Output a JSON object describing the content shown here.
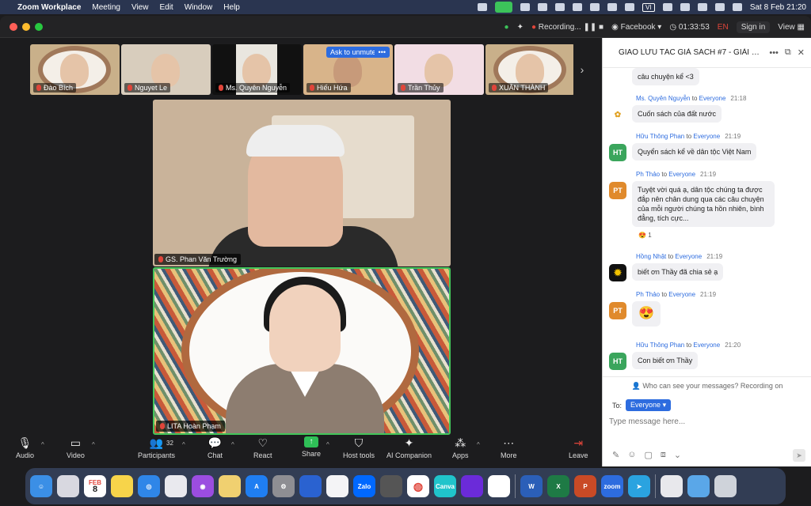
{
  "menubar": {
    "app": "Zoom Workplace",
    "items": [
      "Meeting",
      "View",
      "Edit",
      "Window",
      "Help"
    ],
    "input_source": "VI",
    "datetime": "Sat 8 Feb  21:20"
  },
  "titlebar": {
    "recording": "Recording...",
    "facebook": "Facebook",
    "timer": "01:33:53",
    "lang": "EN",
    "signin": "Sign in",
    "view": "View"
  },
  "strip": {
    "participants": [
      {
        "name": "Đào Bích"
      },
      {
        "name": "Nguyet Le"
      },
      {
        "name": "Ms. Quyên Nguyễn"
      },
      {
        "name": "Hiếu Hứa"
      },
      {
        "name": "Trần Thủy"
      },
      {
        "name": "XUÂN THÀNH"
      }
    ],
    "ask_to_unmute": "Ask to unmute",
    "more": "•••"
  },
  "videos": {
    "speaker1": "GS. Phan Văn Trường",
    "speaker2": "LITA Hoàn Phạm"
  },
  "toolbar": {
    "audio": "Audio",
    "video": "Video",
    "participants": "Participants",
    "participants_count": "32",
    "chat": "Chat",
    "react": "React",
    "share": "Share",
    "host_tools": "Host tools",
    "ai_companion": "AI Companion",
    "apps": "Apps",
    "more": "More",
    "leave": "Leave"
  },
  "chat": {
    "title": "GIAO LƯU TÁC GIẢ SÁCH #7 - GIẢI MÃ...",
    "to_word": "to",
    "messages": [
      {
        "text": "câu chuyện kể <3"
      },
      {
        "sender": "Ms. Quyên Nguyễn",
        "to": "Everyone",
        "time": "21:18",
        "text": "Cuốn sách của đất nước"
      },
      {
        "sender": "Hữu Thông Phan",
        "to": "Everyone",
        "time": "21:19",
        "text": "Quyển sách kể về dân tộc Việt Nam",
        "initials": "HT"
      },
      {
        "sender": "Ph Thảo",
        "to": "Everyone",
        "time": "21:19",
        "text": "Tuyệt vời quá ạ, dân tộc chúng ta được đắp nên chân dung qua các câu chuyện của mỗi người chúng ta hồn nhiên, bình đẳng, tích cực...",
        "initials": "PT",
        "reaction": "😍",
        "reaction_count": "1"
      },
      {
        "sender": "Hồng Nhật",
        "to": "Everyone",
        "time": "21:19",
        "text": "biết ơn Thầy đã chia sẻ ạ"
      },
      {
        "sender": "Ph Thảo",
        "to": "Everyone",
        "time": "21:19",
        "text": "😍",
        "initials": "PT"
      },
      {
        "sender": "Hữu Thông Phan",
        "to": "Everyone",
        "time": "21:20",
        "text": "Con biết ơn Thầy",
        "initials": "HT"
      }
    ],
    "who_can_see": "Who can see your messages? Recording on",
    "to_label": "To:",
    "recipient": "Everyone",
    "placeholder": "Type message here..."
  },
  "dock": {
    "calendar_month": "FEB",
    "calendar_day": "8",
    "zalo": "Zalo",
    "canva": "Canva",
    "zoom": "zoom"
  },
  "colors": {
    "accent_blue": "#2d6cdf",
    "share_green": "#2fbf57",
    "mic_off_red": "#e0453a",
    "active_speaker": "#43c55a"
  }
}
